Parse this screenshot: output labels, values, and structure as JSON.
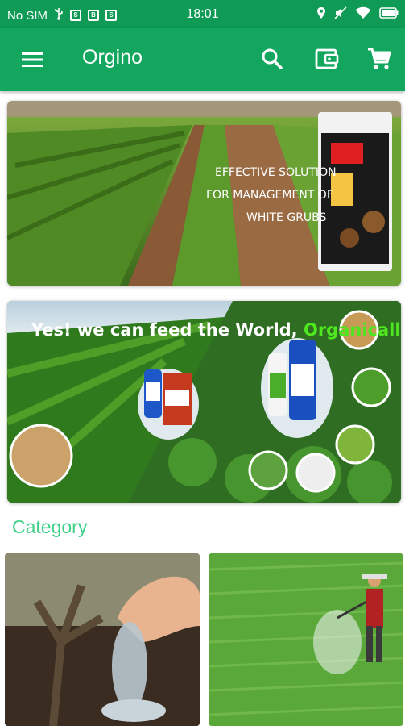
{
  "status_bar": {
    "carrier": "No SIM",
    "time": "18:01",
    "notif_icons": [
      "S",
      "B",
      "S"
    ]
  },
  "app_bar": {
    "title": "Orgino"
  },
  "banner1": {
    "line1": "EFFECTIVE SOLUTION",
    "line2": "FOR MANAGEMENT OF",
    "line3": "WHITE GRUBS"
  },
  "banner2": {
    "headline_prefix": "Yes! we can feed the World, ",
    "headline_highlight": "Organically"
  },
  "category": {
    "title": "Category"
  },
  "colors": {
    "status_bar": "#0f9a55",
    "app_bar": "#13a65f",
    "category_title": "#3fd088"
  },
  "icons": [
    "menu-icon",
    "search-icon",
    "wallet-icon",
    "cart-icon",
    "location-icon",
    "wifi-icon",
    "battery-icon"
  ]
}
